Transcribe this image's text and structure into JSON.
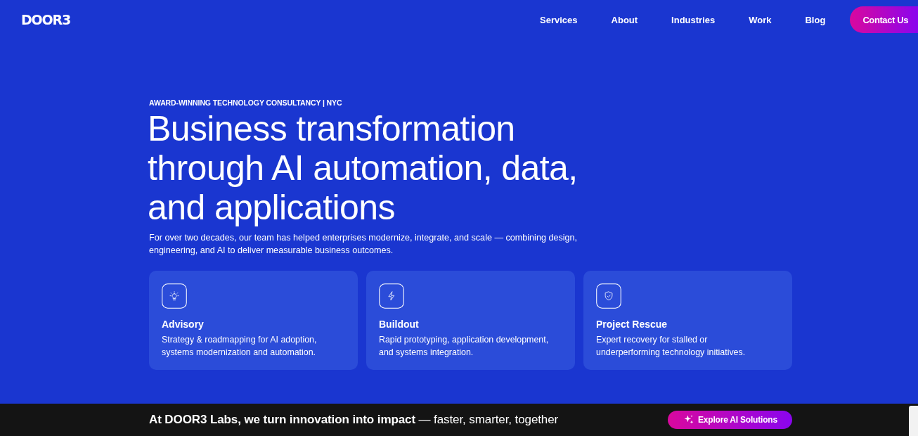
{
  "header": {
    "logo": "DOOR3",
    "nav": [
      {
        "label": "Services"
      },
      {
        "label": "About"
      },
      {
        "label": "Industries"
      },
      {
        "label": "Work"
      },
      {
        "label": "Blog"
      }
    ],
    "cta": "Contact Us"
  },
  "hero": {
    "eyebrow": "AWARD-WINNING TECHNOLOGY CONSULTANCY | NYC",
    "title": "Business transformation through AI automation, data, and applications",
    "lead": "For over two decades, our team has helped enterprises modernize, integrate, and scale — combining design, engineering, and AI to deliver measurable business outcomes.",
    "cards": [
      {
        "kind": "lightbulb",
        "title": "Advisory",
        "text": "Strategy & roadmapping for AI adoption, systems modernization and automation."
      },
      {
        "kind": "bolt",
        "title": "Buildout",
        "text": "Rapid prototyping, application development, and systems integration."
      },
      {
        "kind": "shield",
        "title": "Project Rescue",
        "text": "Expert recovery for stalled or underperforming technology initiatives."
      }
    ]
  },
  "banner": {
    "text": "**At DOOR3 Labs, we turn innovation into impact** — faster, smarter, together",
    "button": "Explore AI Solutions"
  }
}
